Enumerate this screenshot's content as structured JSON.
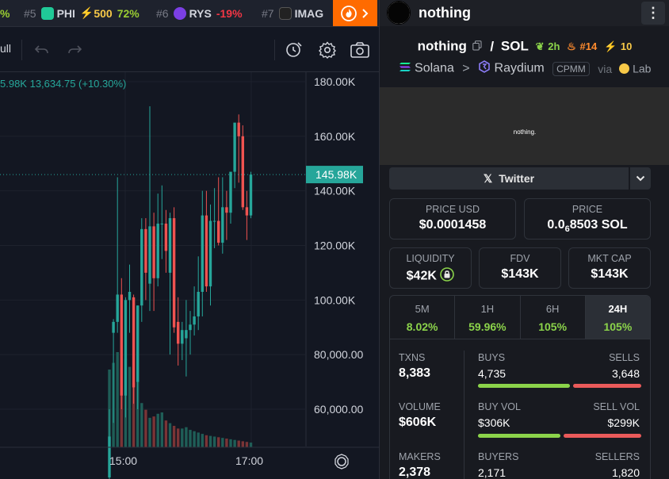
{
  "ticker": {
    "items": [
      {
        "rank": "",
        "name": "",
        "change": "%",
        "change_color": "#9acd32",
        "icon_color": ""
      },
      {
        "rank": "#5",
        "name": "PHI",
        "boost": "500",
        "change": "72%",
        "change_color": "#9acd32",
        "icon_color": "#20c997"
      },
      {
        "rank": "#6",
        "name": "RYS",
        "change": "-19%",
        "change_color": "#f23645",
        "icon_color": "#7b3fe4"
      },
      {
        "rank": "#7",
        "name": "IMAG",
        "change": "",
        "change_color": "",
        "icon_color": "#222222"
      }
    ]
  },
  "toolbar": {
    "left_text": "ull"
  },
  "chart_data": {
    "type": "candlestick",
    "legend_text": "5.98K  13,634.75 (+10.30%)",
    "current_price_label": "145.98K",
    "current_price": 145980,
    "y_tick_labels": [
      "180.00K",
      "160.00K",
      "140.00K",
      "120.00K",
      "100.00K",
      "80,000.00",
      "60,000.00"
    ],
    "y_ticks": [
      180000,
      160000,
      140000,
      120000,
      100000,
      80000,
      60000
    ],
    "x_tick_labels": [
      "15:00",
      "17:00"
    ],
    "up_color": "#26a69a",
    "down_color": "#ef5350",
    "candles": [
      {
        "o": 35000,
        "h": 60000,
        "l": 20000,
        "c": 50000
      },
      {
        "o": 88000,
        "h": 93000,
        "l": 55000,
        "c": 92000
      },
      {
        "o": 92000,
        "h": 145000,
        "l": 88000,
        "c": 102000
      },
      {
        "o": 102000,
        "h": 108000,
        "l": 60000,
        "c": 65000
      },
      {
        "o": 65000,
        "h": 101000,
        "l": 57000,
        "c": 100000
      },
      {
        "o": 100000,
        "h": 113000,
        "l": 88000,
        "c": 103000
      },
      {
        "o": 101000,
        "h": 102000,
        "l": 62000,
        "c": 68000
      },
      {
        "o": 70000,
        "h": 98000,
        "l": 60000,
        "c": 98000
      },
      {
        "o": 98000,
        "h": 130000,
        "l": 92000,
        "c": 126000
      },
      {
        "o": 126000,
        "h": 130000,
        "l": 100000,
        "c": 110000
      },
      {
        "o": 106000,
        "h": 171000,
        "l": 96000,
        "c": 127000
      },
      {
        "o": 127000,
        "h": 132000,
        "l": 96000,
        "c": 108000
      },
      {
        "o": 108000,
        "h": 139000,
        "l": 105000,
        "c": 128000
      },
      {
        "o": 128000,
        "h": 142000,
        "l": 115000,
        "c": 128000
      },
      {
        "o": 128000,
        "h": 133000,
        "l": 110000,
        "c": 118000
      },
      {
        "o": 110000,
        "h": 132000,
        "l": 80000,
        "c": 130000
      },
      {
        "o": 130000,
        "h": 134000,
        "l": 88000,
        "c": 90000
      },
      {
        "o": 92000,
        "h": 101000,
        "l": 76000,
        "c": 84000
      },
      {
        "o": 84000,
        "h": 92000,
        "l": 78000,
        "c": 89000
      },
      {
        "o": 86000,
        "h": 100000,
        "l": 72000,
        "c": 89000
      },
      {
        "o": 89000,
        "h": 96000,
        "l": 80000,
        "c": 91000
      },
      {
        "o": 91000,
        "h": 105000,
        "l": 87000,
        "c": 94000
      },
      {
        "o": 94000,
        "h": 116000,
        "l": 89000,
        "c": 103000
      },
      {
        "o": 103000,
        "h": 140000,
        "l": 94000,
        "c": 131000
      },
      {
        "o": 131000,
        "h": 140000,
        "l": 103000,
        "c": 105000
      },
      {
        "o": 105000,
        "h": 135000,
        "l": 98000,
        "c": 129000
      },
      {
        "o": 129000,
        "h": 141000,
        "l": 119000,
        "c": 129000
      },
      {
        "o": 129000,
        "h": 145000,
        "l": 120000,
        "c": 121000
      },
      {
        "o": 121000,
        "h": 145000,
        "l": 117000,
        "c": 134000
      },
      {
        "o": 134000,
        "h": 140000,
        "l": 122000,
        "c": 132000
      },
      {
        "o": 132000,
        "h": 145000,
        "l": 128000,
        "c": 147000
      },
      {
        "o": 147000,
        "h": 158000,
        "l": 141000,
        "c": 165000
      },
      {
        "o": 165000,
        "h": 168000,
        "l": 143000,
        "c": 160000
      },
      {
        "o": 160000,
        "h": 164000,
        "l": 133000,
        "c": 134000
      },
      {
        "o": 134000,
        "h": 140000,
        "l": 122000,
        "c": 131000
      },
      {
        "o": 131000,
        "h": 147000,
        "l": 130000,
        "c": 145980
      }
    ],
    "volumes": [
      58000,
      63000,
      71000,
      59000,
      66000,
      60000,
      48000,
      50000,
      33000,
      28000,
      22000,
      23000,
      25000,
      26000,
      20000,
      18000,
      16000,
      14000,
      14000,
      15000,
      13000,
      12000,
      11000,
      10000,
      9000,
      8500,
      8000,
      7500,
      7000,
      6500,
      6000,
      5500,
      5000,
      4500,
      4000,
      3500
    ]
  },
  "panel": {
    "token_name": "nothing",
    "pair_base": "nothing",
    "pair_sep": "/",
    "pair_quote": "SOL",
    "age": "2h",
    "rank": "#14",
    "boosts": "10",
    "chain": "Solana",
    "chevron": ">",
    "dex": "Raydium",
    "pool_type": "CPMM",
    "via": "via",
    "launchpad": "Lab",
    "banner_text": "nothing.",
    "twitter_label": "Twitter",
    "price_usd_label": "PRICE USD",
    "price_usd": "$0.0001458",
    "price_label": "PRICE",
    "price_sol_prefix": "0.0",
    "price_sol_zeros": "6",
    "price_sol_suffix": "8503 SOL",
    "liquidity_label": "LIQUIDITY",
    "liquidity": "$42K",
    "fdv_label": "FDV",
    "fdv": "$143K",
    "mktcap_label": "MKT CAP",
    "mktcap": "$143K",
    "timeframes": [
      {
        "label": "5M",
        "value": "8.02%"
      },
      {
        "label": "1H",
        "value": "59.96%"
      },
      {
        "label": "6H",
        "value": "105%"
      },
      {
        "label": "24H",
        "value": "105%"
      }
    ],
    "txns_label": "TXNS",
    "txns": "8,383",
    "buys_label": "BUYS",
    "buys": "4,735",
    "sells_label": "SELLS",
    "sells": "3,648",
    "buy_share": 0.565,
    "volume_label": "VOLUME",
    "volume": "$606K",
    "buy_vol_label": "BUY VOL",
    "buy_vol": "$306K",
    "sell_vol_label": "SELL VOL",
    "sell_vol": "$299K",
    "buy_vol_share": 0.505,
    "makers_label": "MAKERS",
    "makers": "2,378",
    "buyers_label": "BUYERS",
    "buyers": "2,171",
    "sellers_label": "SELLERS",
    "sellers": "1,820",
    "colors": {
      "positive": "#8bd34a",
      "buy_bar": "#8bd34a",
      "sell_bar": "#ea5a5a",
      "rank": "#ff8c2e",
      "boost": "#f7c948"
    }
  }
}
